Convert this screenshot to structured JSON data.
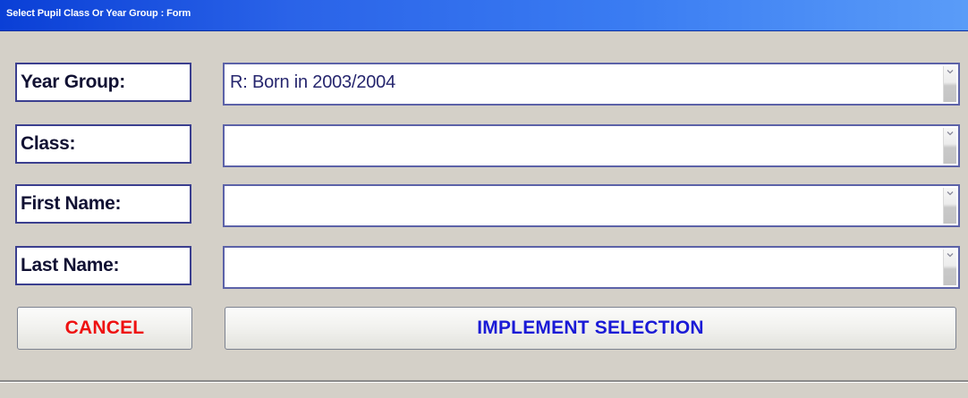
{
  "window": {
    "title": "Select Pupil Class Or Year Group : Form"
  },
  "fields": [
    {
      "label": "Year Group:",
      "value": "R: Born in 2003/2004"
    },
    {
      "label": "Class:",
      "value": ""
    },
    {
      "label": "First Name:",
      "value": ""
    },
    {
      "label": "Last Name:",
      "value": ""
    }
  ],
  "buttons": {
    "cancel_label": "CANCEL",
    "implement_label": "IMPLEMENT SELECTION"
  },
  "colors": {
    "title_bar": "#2a63e8",
    "cancel_text": "#ee1111",
    "implement_text": "#1a1ad6",
    "field_border": "#3b3f8f",
    "background": "#d4d0c8"
  },
  "icons": {
    "dropdown": "chevron-down-icon"
  }
}
